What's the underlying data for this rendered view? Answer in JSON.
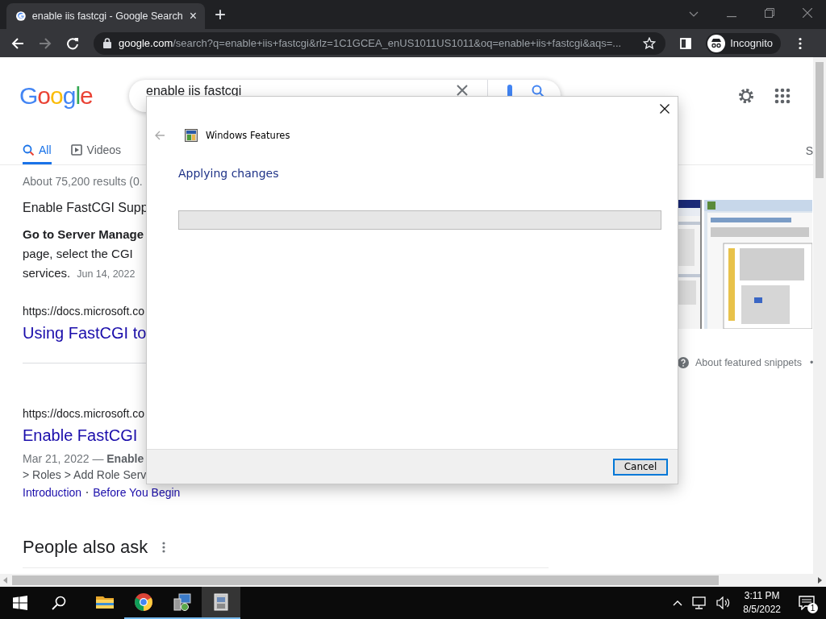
{
  "browser": {
    "tab": {
      "title": "enable iis fastcgi - Google Search",
      "close": "×"
    },
    "new_tab": "+",
    "url_host": "google.com",
    "url_path": "/search?q=enable+iis+fastcgi&rlz=1C1GCEA_enUS1011US1011&oq=enable+iis+fastcgi&aqs=...",
    "profile": "Incognito"
  },
  "google": {
    "logo": "Google",
    "query": "enable iis fastcgi",
    "tabs": [
      {
        "label": "All",
        "selected": true
      },
      {
        "label": "Videos",
        "selected": false
      }
    ],
    "tab_overflow": "S",
    "results_count": "About 75,200 results (0.",
    "snippet": {
      "title": "Enable FastCGI Supp",
      "lines": [
        "**Go to Server Manage**",
        "page, select the CGI",
        "services."
      ],
      "date": "Jun 14, 2022",
      "source_url": "https://docs.microsoft.co",
      "link": "Using FastCGI to"
    },
    "about_snippets": "About featured snippets",
    "more": "•",
    "results": [
      {
        "url": "https://docs.microsoft.co",
        "title": "Enable FastCGI",
        "meta": "Mar 21, 2022 — **Enable**",
        "text": "> Roles > Add Role Serv",
        "sitelinks": [
          "Introduction",
          "Before You Begin"
        ]
      }
    ],
    "people_also_ask": "People also ask"
  },
  "dialog": {
    "title": "Windows Features",
    "heading": "Applying changes",
    "progress": {
      "level": 0
    },
    "buttons": [
      {
        "label": "Cancel",
        "default": true
      }
    ]
  },
  "taskbar": {
    "apps": [
      {
        "kind": "explorer",
        "running": false,
        "active": false
      },
      {
        "kind": "chrome",
        "running": true,
        "active": false
      },
      {
        "kind": "features",
        "running": true,
        "active": false
      },
      {
        "kind": "installer",
        "running": true,
        "active": true
      }
    ],
    "clock": {
      "time": "3:11 PM",
      "date": "8/5/2022"
    },
    "notifications": "1"
  }
}
